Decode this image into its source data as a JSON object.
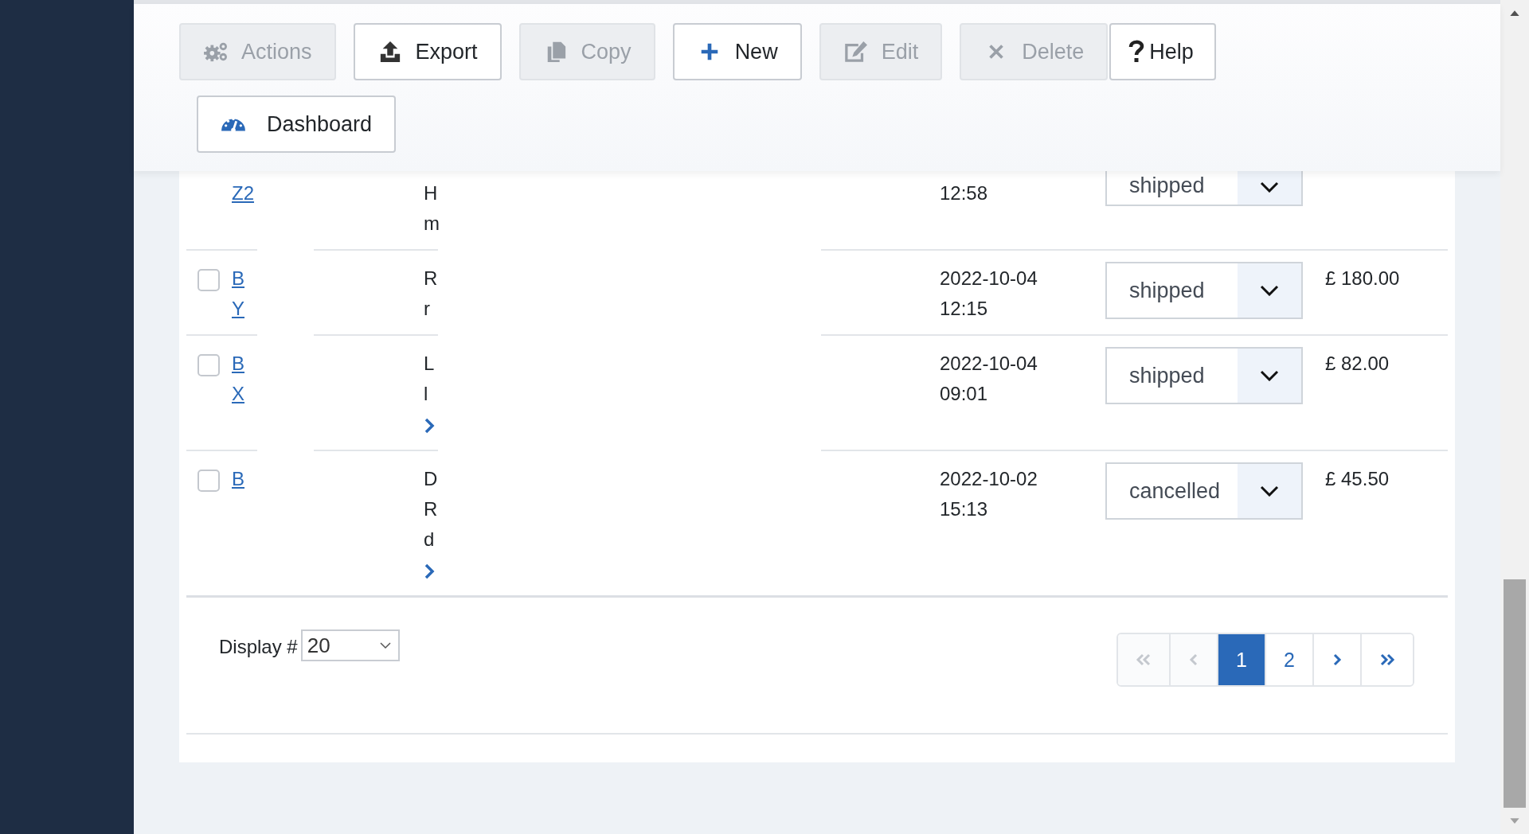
{
  "toolbar": [
    {
      "label": "Actions",
      "disabled": true
    },
    {
      "label": "Export",
      "disabled": false
    },
    {
      "label": "Copy",
      "disabled": true
    },
    {
      "label": "New",
      "disabled": false
    },
    {
      "label": "Edit",
      "disabled": true
    },
    {
      "label": "Delete",
      "disabled": true
    },
    {
      "label": "Help",
      "disabled": false
    },
    {
      "label": "Dashboard",
      "disabled": false
    }
  ],
  "orders": [
    {
      "number_lines": [
        "Z2"
      ],
      "title_lines": [
        "H",
        "m"
      ],
      "expandable": false,
      "time": "12:58",
      "status": "shipped"
    },
    {
      "checked": false,
      "number_lines": [
        "B",
        "Y"
      ],
      "title_lines": [
        "R",
        "r"
      ],
      "expandable": false,
      "date": "2022-10-04",
      "time": "12:15",
      "status": "shipped",
      "total": "£ 180.00"
    },
    {
      "checked": false,
      "number_lines": [
        "B",
        "X"
      ],
      "title_lines": [
        "L",
        "l"
      ],
      "expandable": true,
      "date": "2022-10-04",
      "time": "09:01",
      "status": "shipped",
      "total": "£ 82.00"
    },
    {
      "checked": false,
      "number_lines": [
        "B"
      ],
      "title_lines": [
        "D",
        "R",
        "d"
      ],
      "expandable": true,
      "date": "2022-10-02",
      "time": "15:13",
      "status": "cancelled",
      "total": "£ 45.50"
    }
  ],
  "display": {
    "label": "Display #",
    "value": "20"
  },
  "pagination": [
    {
      "kind": "first",
      "disabled": true,
      "selected": false
    },
    {
      "kind": "prev",
      "disabled": true,
      "selected": false
    },
    {
      "kind": "page",
      "label": "1",
      "disabled": false,
      "selected": true
    },
    {
      "kind": "page",
      "label": "2",
      "disabled": false,
      "selected": false
    },
    {
      "kind": "next",
      "disabled": false,
      "selected": false
    },
    {
      "kind": "last",
      "disabled": false,
      "selected": false
    }
  ]
}
